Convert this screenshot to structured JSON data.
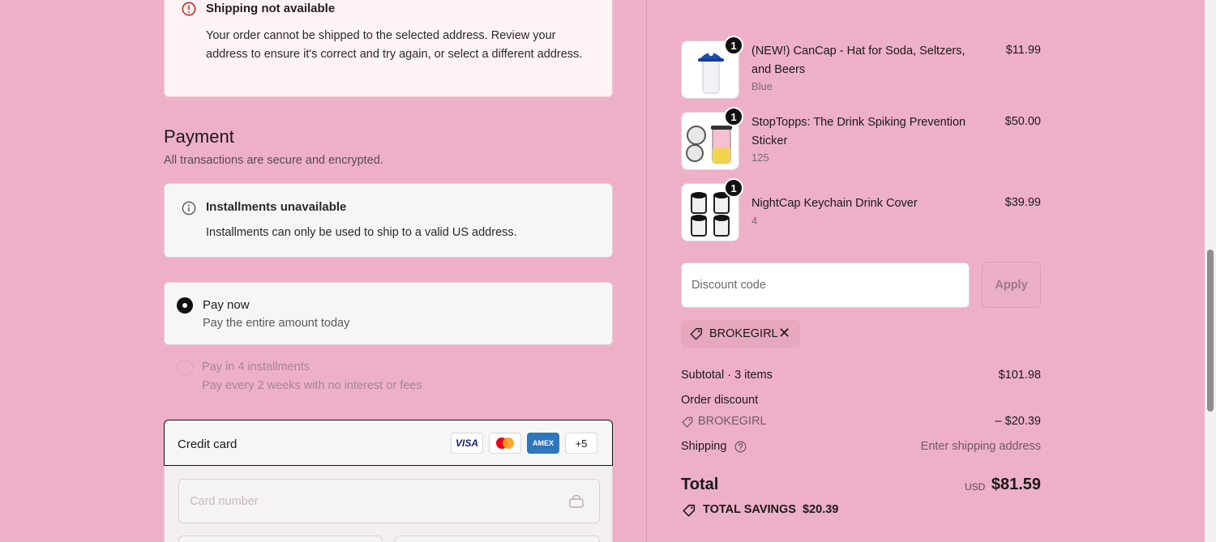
{
  "shipping_alert": {
    "title": "Shipping not available",
    "body": "Your order cannot be shipped to the selected address. Review your address to ensure it's correct and try again, or select a different address."
  },
  "payment": {
    "title": "Payment",
    "subtitle": "All transactions are secure and encrypted.",
    "installments_alert": {
      "title": "Installments unavailable",
      "body": "Installments can only be used to ship to a valid US address."
    },
    "options": [
      {
        "label": "Pay now",
        "desc": "Pay the entire amount today",
        "selected": true
      },
      {
        "label": "Pay in 4 installments",
        "desc": "Pay every 2 weeks with no interest or fees",
        "selected": false
      }
    ],
    "credit_card": {
      "label": "Credit card",
      "brands": [
        "VISA",
        "Mastercard",
        "AMEX"
      ],
      "more": "+5",
      "card_number_placeholder": "Card number"
    }
  },
  "order": {
    "items": [
      {
        "qty": "1",
        "title": "(NEW!) CanCap - Hat for Soda, Seltzers, and Beers",
        "variant": "Blue",
        "price": "$11.99"
      },
      {
        "qty": "1",
        "title": "StopTopps: The Drink Spiking Prevention Sticker",
        "variant": "125",
        "price": "$50.00"
      },
      {
        "qty": "1",
        "title": "NightCap Keychain Drink Cover",
        "variant": "4",
        "price": "$39.99"
      }
    ],
    "discount_placeholder": "Discount code",
    "apply_label": "Apply",
    "applied_code": "BROKEGIRL",
    "subtotal_label": "Subtotal · 3 items",
    "subtotal_value": "$101.98",
    "order_discount_label": "Order discount",
    "order_discount_code": "BROKEGIRL",
    "order_discount_value": "– $20.39",
    "shipping_label": "Shipping",
    "shipping_value": "Enter shipping address",
    "total_label": "Total",
    "currency": "USD",
    "total_value": "$81.59",
    "savings_label": "TOTAL SAVINGS",
    "savings_value": "$20.39"
  },
  "colors": {
    "background": "#eeb0c9",
    "accent": "#111111",
    "error": "#c62828"
  }
}
